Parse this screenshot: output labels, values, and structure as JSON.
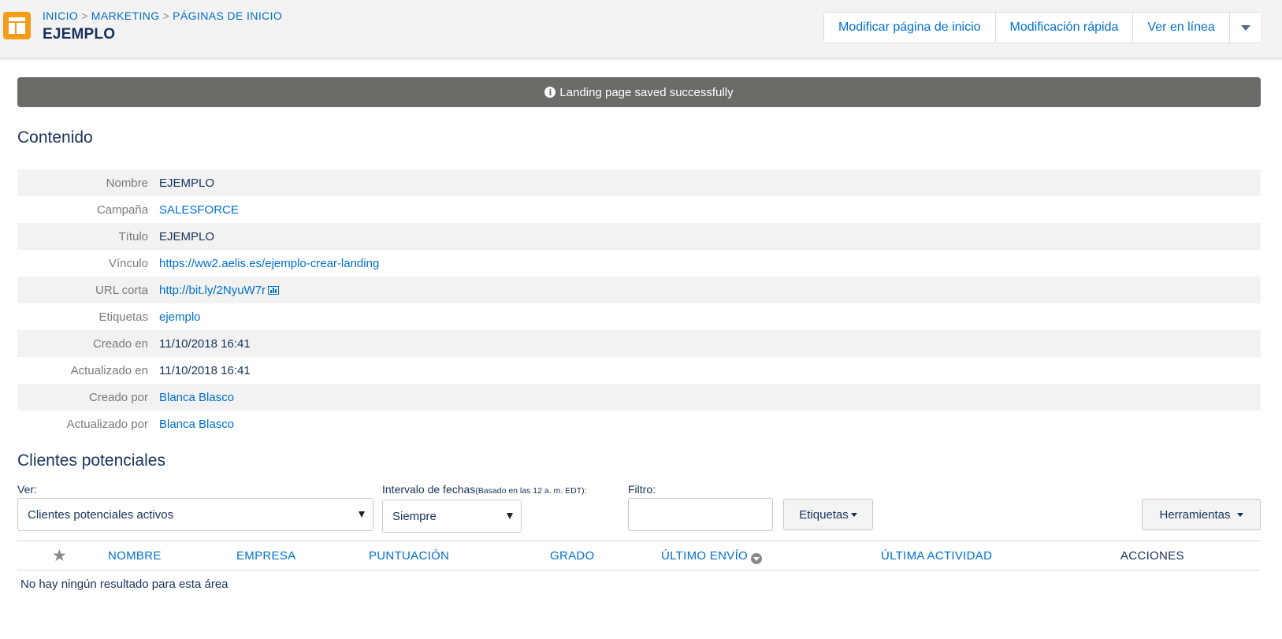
{
  "header": {
    "breadcrumb": [
      "INICIO",
      "MARKETING",
      "PÁGINAS DE INICIO"
    ],
    "breadcrumb_separator": ">",
    "title": "EJEMPLO",
    "actions": {
      "edit_label": "Modificar página de inicio",
      "quick_edit_label": "Modificación rápida",
      "view_online_label": "Ver en línea"
    },
    "accent_color": "#f49c1a"
  },
  "toast": {
    "message": "Landing page saved successfully",
    "icon": "info-icon"
  },
  "content": {
    "title": "Contenido",
    "rows": [
      {
        "label": "Nombre",
        "value": "EJEMPLO"
      },
      {
        "label": "Campaña",
        "value": "SALESFORCE"
      },
      {
        "label": "Título",
        "value": "EJEMPLO"
      },
      {
        "label": "Vínculo",
        "value": "https://ww2.aelis.es/ejemplo-crear-landing"
      },
      {
        "label": "URL corta",
        "value": "http://bit.ly/2NyuW7r"
      },
      {
        "label": "Etiquetas",
        "value": "ejemplo"
      },
      {
        "label": "Creado en",
        "value": "11/10/2018 16:41"
      },
      {
        "label": "Actualizado en",
        "value": "11/10/2018 16:41"
      },
      {
        "label": "Creado por",
        "value": "Blanca Blasco"
      },
      {
        "label": "Actualizado por",
        "value": "Blanca Blasco"
      }
    ]
  },
  "prospects": {
    "title": "Clientes potenciales",
    "view_label": "Ver:",
    "view_value": "Clientes potenciales activos",
    "date_range_label": "Intervalo de fechas",
    "date_range_note": "(Basado en las 12 a. m. EDT):",
    "date_range_value": "Siempre",
    "filter_label": "Filtro:",
    "filter_value": "",
    "tags_button": "Etiquetas",
    "tools_button": "Herramientas",
    "columns": {
      "name": "NOMBRE",
      "company": "EMPRESA",
      "score": "PUNTUACIÓN",
      "grade": "GRADO",
      "last_send": "ÚLTIMO ENVÍO",
      "last_activity": "ÚLTIMA ACTIVIDAD",
      "actions": "ACCIONES"
    },
    "empty_message": "No hay ningún resultado para esta área"
  }
}
